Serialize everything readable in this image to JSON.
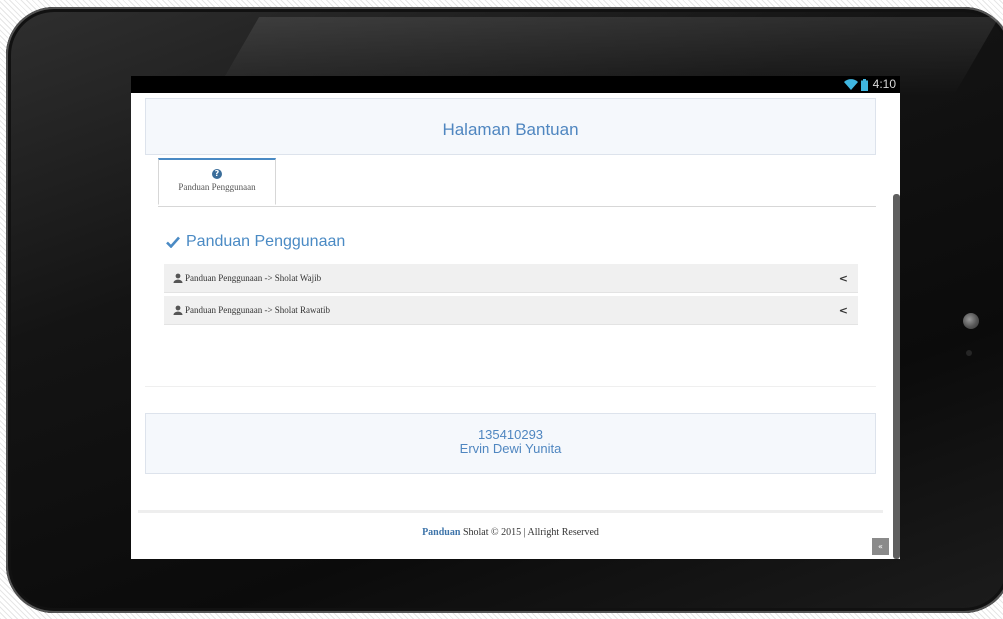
{
  "statusbar": {
    "time": "4:10",
    "wifi_icon": "wifi-icon",
    "battery_icon": "battery-icon"
  },
  "header": {
    "title": "Halaman Bantuan"
  },
  "tabs": [
    {
      "label": "Panduan Penggunaan",
      "icon": "question-circle-icon",
      "icon_glyph": "?",
      "active": true
    }
  ],
  "section": {
    "title": "Panduan Penggunaan",
    "icon": "check-icon",
    "items": [
      {
        "label": "Panduan Penggunaan -> Sholat Wajib",
        "icon": "user-icon",
        "chevron": "<"
      },
      {
        "label": "Panduan Penggunaan -> Sholat Rawatib",
        "icon": "user-icon",
        "chevron": "<"
      }
    ]
  },
  "info": {
    "id": "135410293",
    "name": "Ervin Dewi Yunita"
  },
  "footer": {
    "brand": "Panduan",
    "text": " Sholat © 2015 | Allright Reserved"
  },
  "scrolltop": {
    "glyph": "«"
  },
  "colors": {
    "accent": "#4a8ac4",
    "panel_bg": "#f5f8fc",
    "row_bg": "#f0f0f0"
  }
}
